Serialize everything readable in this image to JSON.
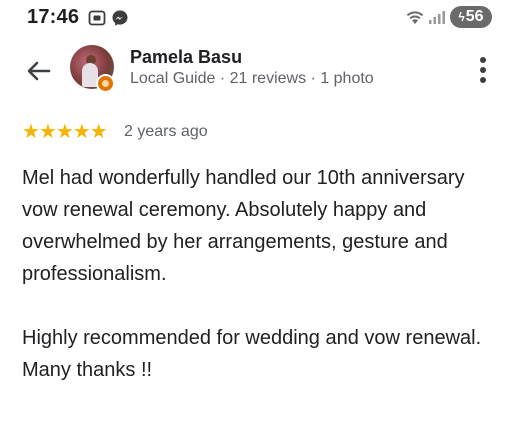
{
  "status_bar": {
    "time": "17:46",
    "battery": "56",
    "icons": [
      "screen-record-icon",
      "messenger-icon",
      "wifi-icon",
      "signal-icon",
      "battery-icon"
    ]
  },
  "header": {
    "back_icon": "arrow-back-icon",
    "reviewer_name": "Pamela Basu",
    "reviewer_meta": "Local Guide · 21 reviews · 1 photo",
    "more_icon": "more-vert-icon"
  },
  "rating": {
    "stars": 5,
    "max_stars": 5,
    "star_color": "#f4b400",
    "time_ago": "2 years ago"
  },
  "review": {
    "paragraph_1": "Mel had wonderfully handled our 10th anniversary vow renewal ceremony. Absolutely happy and overwhelmed by her arrangements, gesture and professionalism.",
    "paragraph_2_line_1": "Highly recommended for wedding and vow renewal.",
    "paragraph_2_line_2": "Many thanks !!"
  }
}
